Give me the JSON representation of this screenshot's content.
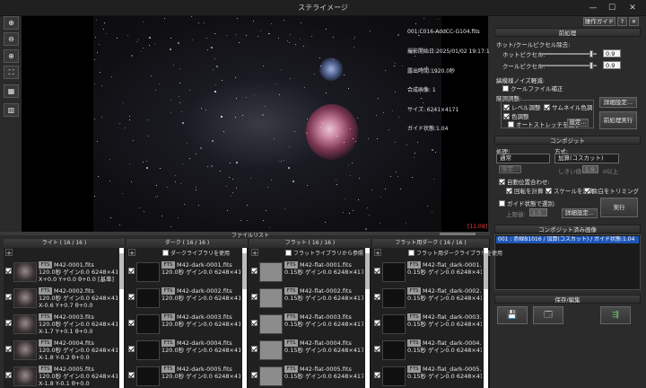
{
  "window": {
    "title": "ステライメージ",
    "min": "—",
    "max": "☐",
    "close": "✕"
  },
  "toolbar": {
    "zoom_in": "⊕",
    "zoom_out": "⊖",
    "zoom_fit": "⊕",
    "fullscreen": "⛶",
    "grid": "▦",
    "split": "▥"
  },
  "viewer": {
    "info_lines": [
      "001:C016-AddCC-G104.fits",
      "撮影開始日:2025/01/02 19:17:11",
      "露出時間:1920.0秒",
      "合成画像: 1",
      "サイズ: 6241×4171",
      "ガイド状態:1.04"
    ],
    "badge": "[11:09]"
  },
  "sidebar": {
    "guide_button": "操作ガイド",
    "help": "?",
    "pin": "✕",
    "preprocess": {
      "header": "前処理",
      "hot_cold_title": "ホット/クールピクセル除去:",
      "hot_label": "ホットピクセル:",
      "hot_value": "0.9",
      "cold_label": "クールピクセル:",
      "cold_value": "0.9",
      "pattern_title": "縞模様ノイズ軽減:",
      "cool_file": "クールファイル補正",
      "adjust_title": "階調調整:",
      "level": "レベル調整",
      "thumb_color": "サムネイル色調",
      "color": "色調整",
      "auto_stretch": "オートストレッチを使う",
      "settings_btn": "設定...",
      "detail_btn": "詳細設定...",
      "run_btn": "前処理実行"
    },
    "composite": {
      "header": "コンポジット",
      "proc_label": "処理:",
      "proc_value": "通常",
      "method_label": "方式:",
      "method_value": "加算(コスカット)",
      "settings": "設定...",
      "threshold_label": "しきい値:",
      "threshold_value": "1.9",
      "above": "σ以上",
      "auto_align": "自動位置合わせ:",
      "rotate": "回転を計算",
      "scale": "スケールを演算",
      "color_trim": "余白をトリミング",
      "guide_weight": "ガイド状態で選別:",
      "upper_label": "上限値:",
      "upper_value": "1.5",
      "detail_btn": "詳細設定...",
      "run_btn": "実行"
    },
    "history": {
      "header": "コンポジット済み画像",
      "item": "001 : 赤緑B1016 / 加算(コスカット) / ガイド状態:1.04"
    },
    "save": {
      "header": "保存/編集",
      "save_icon": "💾",
      "window_icon": "🗔",
      "export_icon": "⇶"
    }
  },
  "filelist": {
    "title": "ファイルリスト",
    "lights": {
      "header": "ライト ( 16 / 16 )",
      "rows": [
        {
          "name": "M42-0001.fits",
          "l2": "120.0秒 ゲイン0.0 6248×417",
          "l3": "X+0.0 Y+0.0 θ+0.0 [基準]"
        },
        {
          "name": "M42-0002.fits",
          "l2": "120.0秒 ゲイン0.0 6248×417",
          "l3": "X-0.6 Y+0.7 θ+0.0"
        },
        {
          "name": "M42-0003.fits",
          "l2": "120.0秒 ゲイン0.0 6248×417",
          "l3": "X-1.7 Y+0.1 θ+0.0"
        },
        {
          "name": "M42-0004.fits",
          "l2": "120.0秒 ゲイン0.0 6248×417",
          "l3": "X-1.8 Y-0.2 θ+0.0"
        },
        {
          "name": "M42-0005.fits",
          "l2": "120.0秒 ゲイン0.0 6248×417",
          "l3": "X-1.8 Y-0.1 θ+0.0"
        }
      ]
    },
    "darks": {
      "header": "ダーク ( 16 / 16 )",
      "use_lib": "ダークライブラリを使用",
      "rows": [
        {
          "name": "M42-dark-0001.fits",
          "l2": "120.0秒 ゲイン0.0 6248×417"
        },
        {
          "name": "M42-dark-0002.fits",
          "l2": "120.0秒 ゲイン0.0 6248×417"
        },
        {
          "name": "M42-dark-0003.fits",
          "l2": "120.0秒 ゲイン0.0 6248×417"
        },
        {
          "name": "M42-dark-0004.fits",
          "l2": "120.0秒 ゲイン0.0 6248×417"
        },
        {
          "name": "M42-dark-0005.fits",
          "l2": "120.0秒 ゲイン0.0 6248×417"
        }
      ]
    },
    "flats": {
      "header": "フラット ( 16 / 16 )",
      "use_lib": "フラットライブラリから参照",
      "rows": [
        {
          "name": "M42-flat-0001.fits",
          "l2": "0.15秒 ゲイン0.0 6248×4176"
        },
        {
          "name": "M42-flat-0002.fits",
          "l2": "0.15秒 ゲイン0.0 6248×4176"
        },
        {
          "name": "M42-flat-0003.fits",
          "l2": "0.15秒 ゲイン0.0 6248×4176"
        },
        {
          "name": "M42-flat-0004.fits",
          "l2": "0.15秒 ゲイン0.0 6248×4176"
        },
        {
          "name": "M42-flat-0005.fits",
          "l2": "0.15秒 ゲイン0.0 6248×4176"
        }
      ]
    },
    "flatdarks": {
      "header": "フラット用ダーク ( 16 / 16 )",
      "use_lib": "フラット用ダークライブラリを使用",
      "rows": [
        {
          "name": "M42-flat_dark-0001.fits",
          "l2": "0.15秒 ゲイン0.0 6248×4176"
        },
        {
          "name": "M42-flat_dark-0002.fits",
          "l2": "0.15秒 ゲイン0.0 6248×4176"
        },
        {
          "name": "M42-flat_dark-0003.fits",
          "l2": "0.15秒 ゲイン0.0 6248×4176"
        },
        {
          "name": "M42-flat_dark-0004.fits",
          "l2": "0.15秒 ゲイン0.0 6248×4176"
        },
        {
          "name": "M42-flat_dark-0005.fits",
          "l2": "0.15秒 ゲイン0.0 6248×4176"
        }
      ]
    },
    "fts_tag": "FTS",
    "add": "+"
  }
}
